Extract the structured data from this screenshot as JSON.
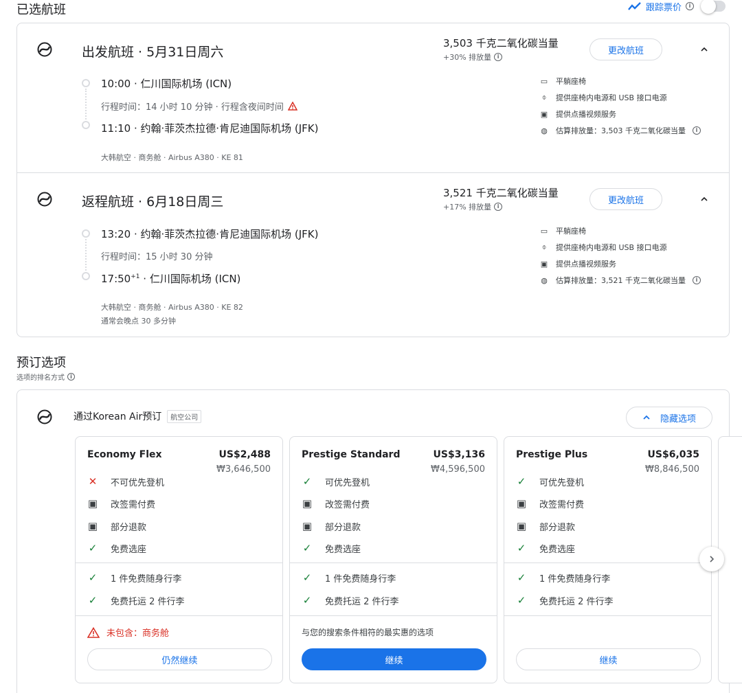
{
  "header": {
    "title": "已选航班",
    "track_label": "跟踪票价",
    "track_toggle": "off"
  },
  "flights": [
    {
      "title": "出发航班 · 5月31日周六",
      "co2": "3,503 千克二氧化碳当量",
      "co2_delta": "+30% 排放量",
      "change_label": "更改航班",
      "dep": "10:00 · 仁川国际机场 (ICN)",
      "duration": "行程时间：14 小时 10 分钟 · 行程含夜间时间",
      "arr": "11:10 · 约翰·菲茨杰拉德·肯尼迪国际机场 (JFK)",
      "meta1": "大韩航空 · 商务舱 · Airbus A380 · KE 81",
      "meta2": "",
      "amenities": [
        "平躺座椅",
        "提供座椅内电源和 USB 接口电源",
        "提供点播视频服务",
        "估算排放量：3,503 千克二氧化碳当量"
      ]
    },
    {
      "title": "返程航班 · 6月18日周三",
      "co2": "3,521 千克二氧化碳当量",
      "co2_delta": "+17% 排放量",
      "change_label": "更改航班",
      "dep": "13:20 · 约翰·菲茨杰拉德·肯尼迪国际机场 (JFK)",
      "duration": "行程时间：15 小时 30 分钟",
      "arr_time": "17:50",
      "arr_sup": "+1",
      "arr_rest": " · 仁川国际机场 (ICN)",
      "meta1": "大韩航空 · 商务舱 · Airbus A380 · KE 82",
      "meta2": "通常会晚点 30 多分钟",
      "amenities": [
        "平躺座椅",
        "提供座椅内电源和 USB 接口电源",
        "提供点播视频服务",
        "估算排放量：3,521 千克二氧化碳当量"
      ]
    }
  ],
  "booking": {
    "title": "预订选项",
    "sort_label": "选项的排名方式",
    "provider": "通过Korean Air预订",
    "provider_badge": "航空公司",
    "hide_label": "隐藏选项",
    "fares": [
      {
        "name": "Economy Flex",
        "usd": "US$2,488",
        "krw": "₩3,646,500",
        "features": [
          {
            "icon": "x-icon",
            "label": "不可优先登机"
          },
          {
            "icon": "money-icon",
            "label": "改签需付费"
          },
          {
            "icon": "money-icon",
            "label": "部分退款"
          },
          {
            "icon": "check-icon",
            "label": "免费选座"
          }
        ],
        "bags": [
          "1 件免费随身行李",
          "免费托运 2 件行李"
        ],
        "note": "未包含：商务舱",
        "cta": "仍然继续"
      },
      {
        "name": "Prestige Standard",
        "usd": "US$3,136",
        "krw": "₩4,596,500",
        "features": [
          {
            "icon": "check-icon",
            "label": "可优先登机"
          },
          {
            "icon": "money-icon",
            "label": "改签需付费"
          },
          {
            "icon": "money-icon",
            "label": "部分退款"
          },
          {
            "icon": "check-icon",
            "label": "免费选座"
          }
        ],
        "bags": [
          "1 件免费随身行李",
          "免费托运 2 件行李"
        ],
        "note": "与您的搜索条件相符的最实惠的选项",
        "cta": "继续"
      },
      {
        "name": "Prestige Plus",
        "usd": "US$6,035",
        "krw": "₩8,846,500",
        "features": [
          {
            "icon": "check-icon",
            "label": "可优先登机"
          },
          {
            "icon": "money-icon",
            "label": "改签需付费"
          },
          {
            "icon": "money-icon",
            "label": "部分退款"
          },
          {
            "icon": "check-icon",
            "label": "免费选座"
          }
        ],
        "bags": [
          "1 件免费随身行李",
          "免费托运 2 件行李"
        ],
        "note": "",
        "cta": "继续"
      }
    ]
  },
  "colors": {
    "accent": "#1a73e8",
    "check": "#188038",
    "warn": "#d93025",
    "border": "#dadce0"
  }
}
